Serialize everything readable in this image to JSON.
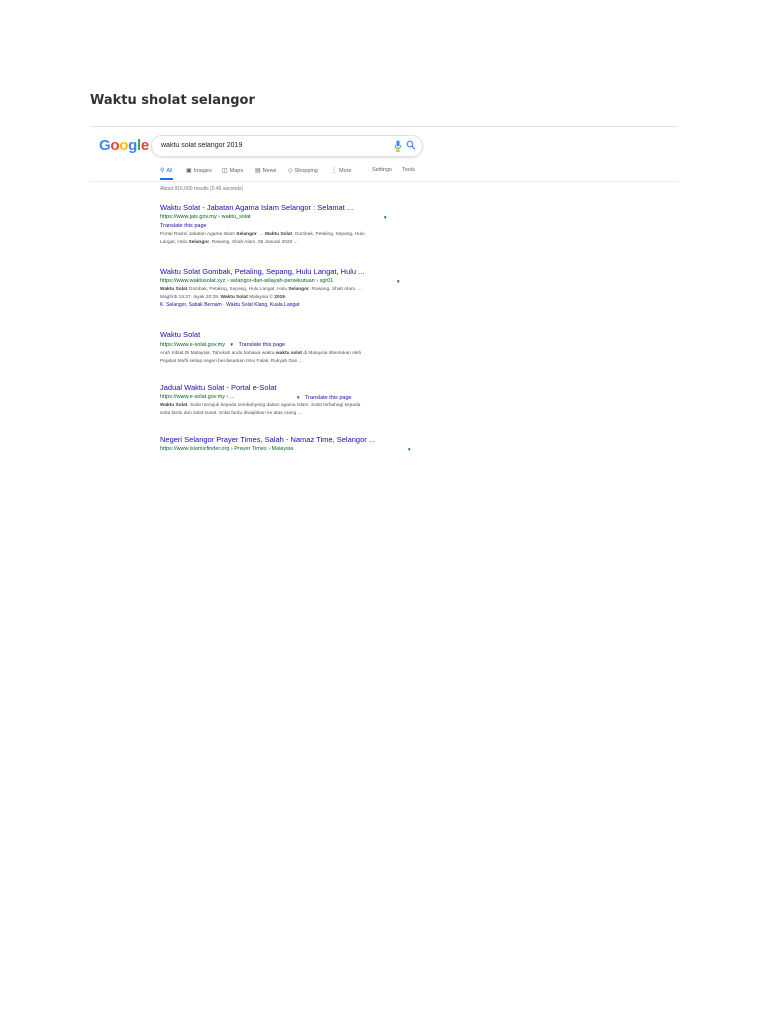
{
  "document": {
    "title": "Waktu sholat selangor"
  },
  "google": {
    "logo_letters": [
      {
        "char": "G",
        "color": "#4285F4"
      },
      {
        "char": "o",
        "color": "#EA4335"
      },
      {
        "char": "o",
        "color": "#FBBC05"
      },
      {
        "char": "g",
        "color": "#4285F4"
      },
      {
        "char": "l",
        "color": "#34A853"
      },
      {
        "char": "e",
        "color": "#EA4335"
      }
    ],
    "search": {
      "value": "waktu solat selangor 2019"
    },
    "tabs": {
      "all": "All",
      "images": "Images",
      "maps": "Maps",
      "news": "News",
      "shopping": "Shopping",
      "more": "More",
      "settings": "Settings",
      "tools": "Tools"
    },
    "stats": "About 916,000 results (0.46 seconds)",
    "results": [
      {
        "title": "Waktu Solat - Jabatan Agama Islam Selangor : Selamat ...",
        "url": "https://www.jais.gov.my › waktu_solat",
        "translate": "Translate this page",
        "snippet_line1": "Portal Rasmi Jabatan Agama Islam Selangor. ... Waktu Solat. Gombak, Petaling, Sepang, Hulu",
        "snippet_line2": "Langat, Hulu Selangor, Rawang, Shah Alam. 08 Januari 2020 ..."
      },
      {
        "title": "Waktu Solat Gombak, Petaling, Sepang, Hulu Langat, Hulu ...",
        "url": "https://www.waktusolat.xyz › selangor-dan-wilayah-persekutuan › sgr01",
        "snippet_line1": "Waktu Solat Gombak, Petaling, Sepang, Hulu Langat, Hulu Selangor, Rawang, Shah Alam. ...",
        "snippet_line2": "Maghrib 19:27. Isyak 20:39. Waktu Solat Malaysia © 2019.",
        "sitelinks": "K. Selangor, Sabak Bernam · Waktu Solat Klang, Kuala Langat"
      },
      {
        "title": "Waktu Solat",
        "url": "https://www.e-solat.gov.my",
        "translate": "Translate this page",
        "snippet_line1": "Arah Kiblat Di Malaysia. Tahukah anda bahawa waktu-waktu solat di Malaysia ditentukan oleh",
        "snippet_line2": "Pejabat Mufti setiap negeri berdasarkan Ilmu Falak, Rukyah Dan ..."
      },
      {
        "title": "Jadual Waktu Solat - Portal e-Solat",
        "url": "https://www.e-solat.gov.my › ...",
        "translate": "Translate this page",
        "snippet_line1": "Waktu Solat. Solat merujuk kepada sembahyang dalam agama Islam. Solat terbahagi kepada",
        "snippet_line2": "solat fardu dan solat sunat. Solat fardu diwajibkan ke atas orang ..."
      },
      {
        "title": "Negeri Selangor Prayer Times, Salah - Namaz Time, Selangor ...",
        "url": "https://www.islamicfinder.org › Prayer Times › Malaysia"
      }
    ]
  }
}
